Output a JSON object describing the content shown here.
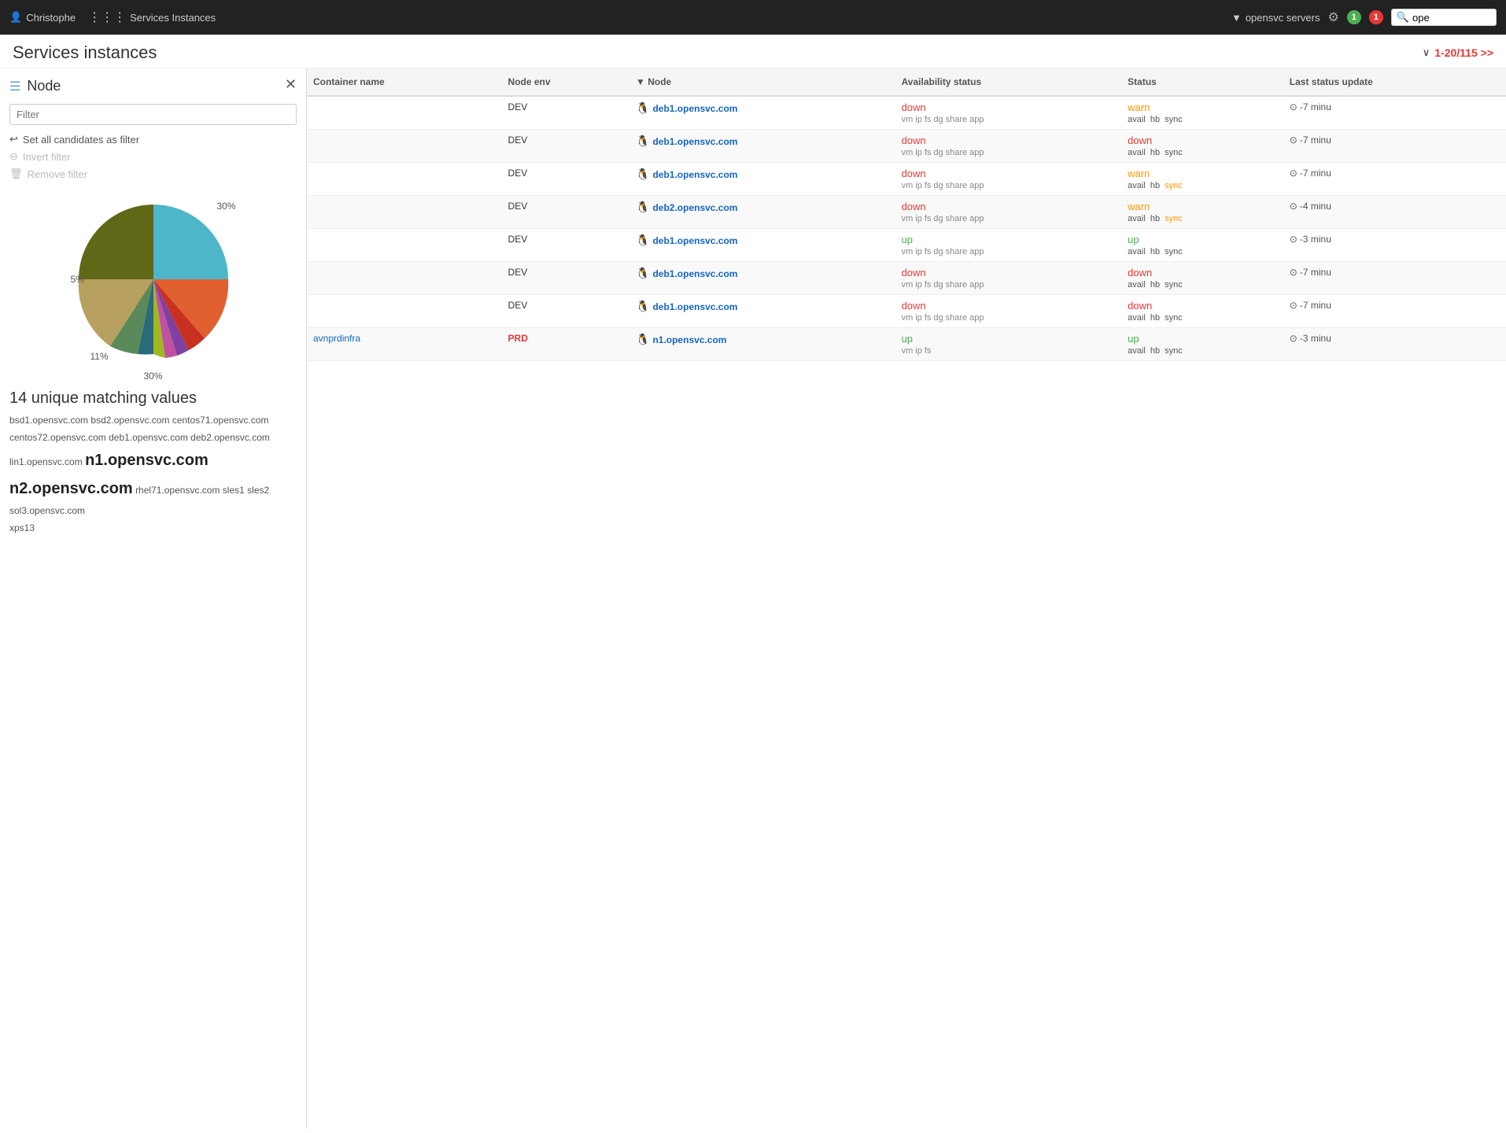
{
  "topnav": {
    "user_icon": "👤",
    "user_name": "Christophe",
    "apps_icon": "⋮⋮⋮",
    "apps_label": "Services Instances",
    "filter_icon": "▼",
    "filter_label": "opensvc servers",
    "gear_icon": "⚙",
    "badge_green": "1",
    "badge_red": "1",
    "search_placeholder": "ope",
    "search_icon": "🔍"
  },
  "page": {
    "title": "Services instances",
    "pagination": "1-20/115 >>",
    "chevron": "∨"
  },
  "sidebar": {
    "close_icon": "✕",
    "section_icon": "☰",
    "section_title": "Node",
    "filter_placeholder": "Filter",
    "actions": [
      {
        "icon": "↩",
        "label": "Set all candidates as filter",
        "disabled": false
      },
      {
        "icon": "⊖",
        "label": "Invert filter",
        "disabled": true
      },
      {
        "icon": "🗑",
        "label": "Remove filter",
        "disabled": true
      }
    ],
    "unique_count": "14 unique matching values",
    "candidates": "bsd1.opensvc.com bsd2.opensvc.com centos71.opensvc.com centos72.opensvc.com deb1.opensvc.com deb2.opensvc.com lin1.opensvc.com n1.opensvc.com n2.opensvc.com rhel71.opensvc.com sles1 sles2 sol3.opensvc.com xps13",
    "pie_labels": {
      "top_right": "30%",
      "left": "5%",
      "bottom_left": "11%",
      "bottom_center": "30%"
    }
  },
  "table": {
    "headers": [
      "Container name",
      "Node env",
      "Node",
      "Availability status",
      "Status",
      "Last status update"
    ],
    "rows": [
      {
        "container": "",
        "env": "DEV",
        "env_class": "dev",
        "node": "deb1.opensvc.com",
        "avail_main": "down",
        "avail_class": "status-down",
        "avail_tags": "vm ip fs dg share app",
        "status_main": "warn",
        "status_class": "status-warn",
        "status_tags_parts": [
          {
            "text": "avail",
            "class": "status-avail"
          },
          {
            "text": "hb",
            "class": "status-avail"
          },
          {
            "text": "sync",
            "class": "status-avail"
          }
        ],
        "time": "-7 minu"
      },
      {
        "container": "",
        "env": "DEV",
        "env_class": "dev",
        "node": "deb1.opensvc.com",
        "avail_main": "down",
        "avail_class": "status-down",
        "avail_tags": "vm ip fs dg share app",
        "status_main": "down",
        "status_class": "status-down",
        "status_tags_parts": [
          {
            "text": "avail",
            "class": "status-avail"
          },
          {
            "text": "hb",
            "class": "status-avail"
          },
          {
            "text": "sync",
            "class": "status-avail"
          }
        ],
        "time": "-7 minu"
      },
      {
        "container": "",
        "env": "DEV",
        "env_class": "dev",
        "node": "deb1.opensvc.com",
        "avail_main": "down",
        "avail_class": "status-down",
        "avail_tags": "vm ip fs dg share app",
        "status_main": "warn",
        "status_class": "status-warn",
        "status_tags_parts": [
          {
            "text": "avail",
            "class": "status-avail"
          },
          {
            "text": "hb",
            "class": "status-avail"
          },
          {
            "text": "sync",
            "class": "status-sync"
          }
        ],
        "time": "-7 minu"
      },
      {
        "container": "",
        "env": "DEV",
        "env_class": "dev",
        "node": "deb2.opensvc.com",
        "avail_main": "down",
        "avail_class": "status-down",
        "avail_tags": "vm ip fs dg share app",
        "status_main": "warn",
        "status_class": "status-warn",
        "status_tags_parts": [
          {
            "text": "avail",
            "class": "status-avail"
          },
          {
            "text": "hb",
            "class": "status-avail"
          },
          {
            "text": "sync",
            "class": "status-sync"
          }
        ],
        "time": "-4 minu"
      },
      {
        "container": "",
        "env": "DEV",
        "env_class": "dev",
        "node": "deb1.opensvc.com",
        "avail_main": "up",
        "avail_class": "status-up",
        "avail_tags": "vm ip fs dg share app",
        "status_main": "up",
        "status_class": "status-up",
        "status_tags_parts": [
          {
            "text": "avail",
            "class": "status-avail"
          },
          {
            "text": "hb",
            "class": "status-avail"
          },
          {
            "text": "sync",
            "class": "status-avail"
          }
        ],
        "time": "-3 minu"
      },
      {
        "container": "",
        "env": "DEV",
        "env_class": "dev",
        "node": "deb1.opensvc.com",
        "avail_main": "down",
        "avail_class": "status-down",
        "avail_tags": "vm ip fs dg share app",
        "status_main": "down",
        "status_class": "status-down",
        "status_tags_parts": [
          {
            "text": "avail",
            "class": "status-avail"
          },
          {
            "text": "hb",
            "class": "status-avail"
          },
          {
            "text": "sync",
            "class": "status-avail"
          }
        ],
        "time": "-7 minu"
      },
      {
        "container": "",
        "env": "DEV",
        "env_class": "dev",
        "node": "deb1.opensvc.com",
        "avail_main": "down",
        "avail_class": "status-down",
        "avail_tags": "vm ip fs dg share app",
        "status_main": "down",
        "status_class": "status-down",
        "status_tags_parts": [
          {
            "text": "avail",
            "class": "status-avail"
          },
          {
            "text": "hb",
            "class": "status-avail"
          },
          {
            "text": "sync",
            "class": "status-avail"
          }
        ],
        "time": "-7 minu"
      },
      {
        "container": "avnprdinfra",
        "env": "PRD",
        "env_class": "prd",
        "node": "n1.opensvc.com",
        "avail_main": "up",
        "avail_class": "status-up",
        "avail_tags": "vm ip fs",
        "status_main": "up",
        "status_class": "status-up",
        "status_tags_parts": [
          {
            "text": "avail",
            "class": "status-avail"
          },
          {
            "text": "hb",
            "class": "status-avail"
          },
          {
            "text": "sync",
            "class": "status-avail"
          }
        ],
        "time": "-3 minu"
      }
    ]
  },
  "colors": {
    "accent_red": "#e53935",
    "accent_green": "#4caf50",
    "accent_orange": "#ff9800",
    "nav_bg": "#222222"
  }
}
